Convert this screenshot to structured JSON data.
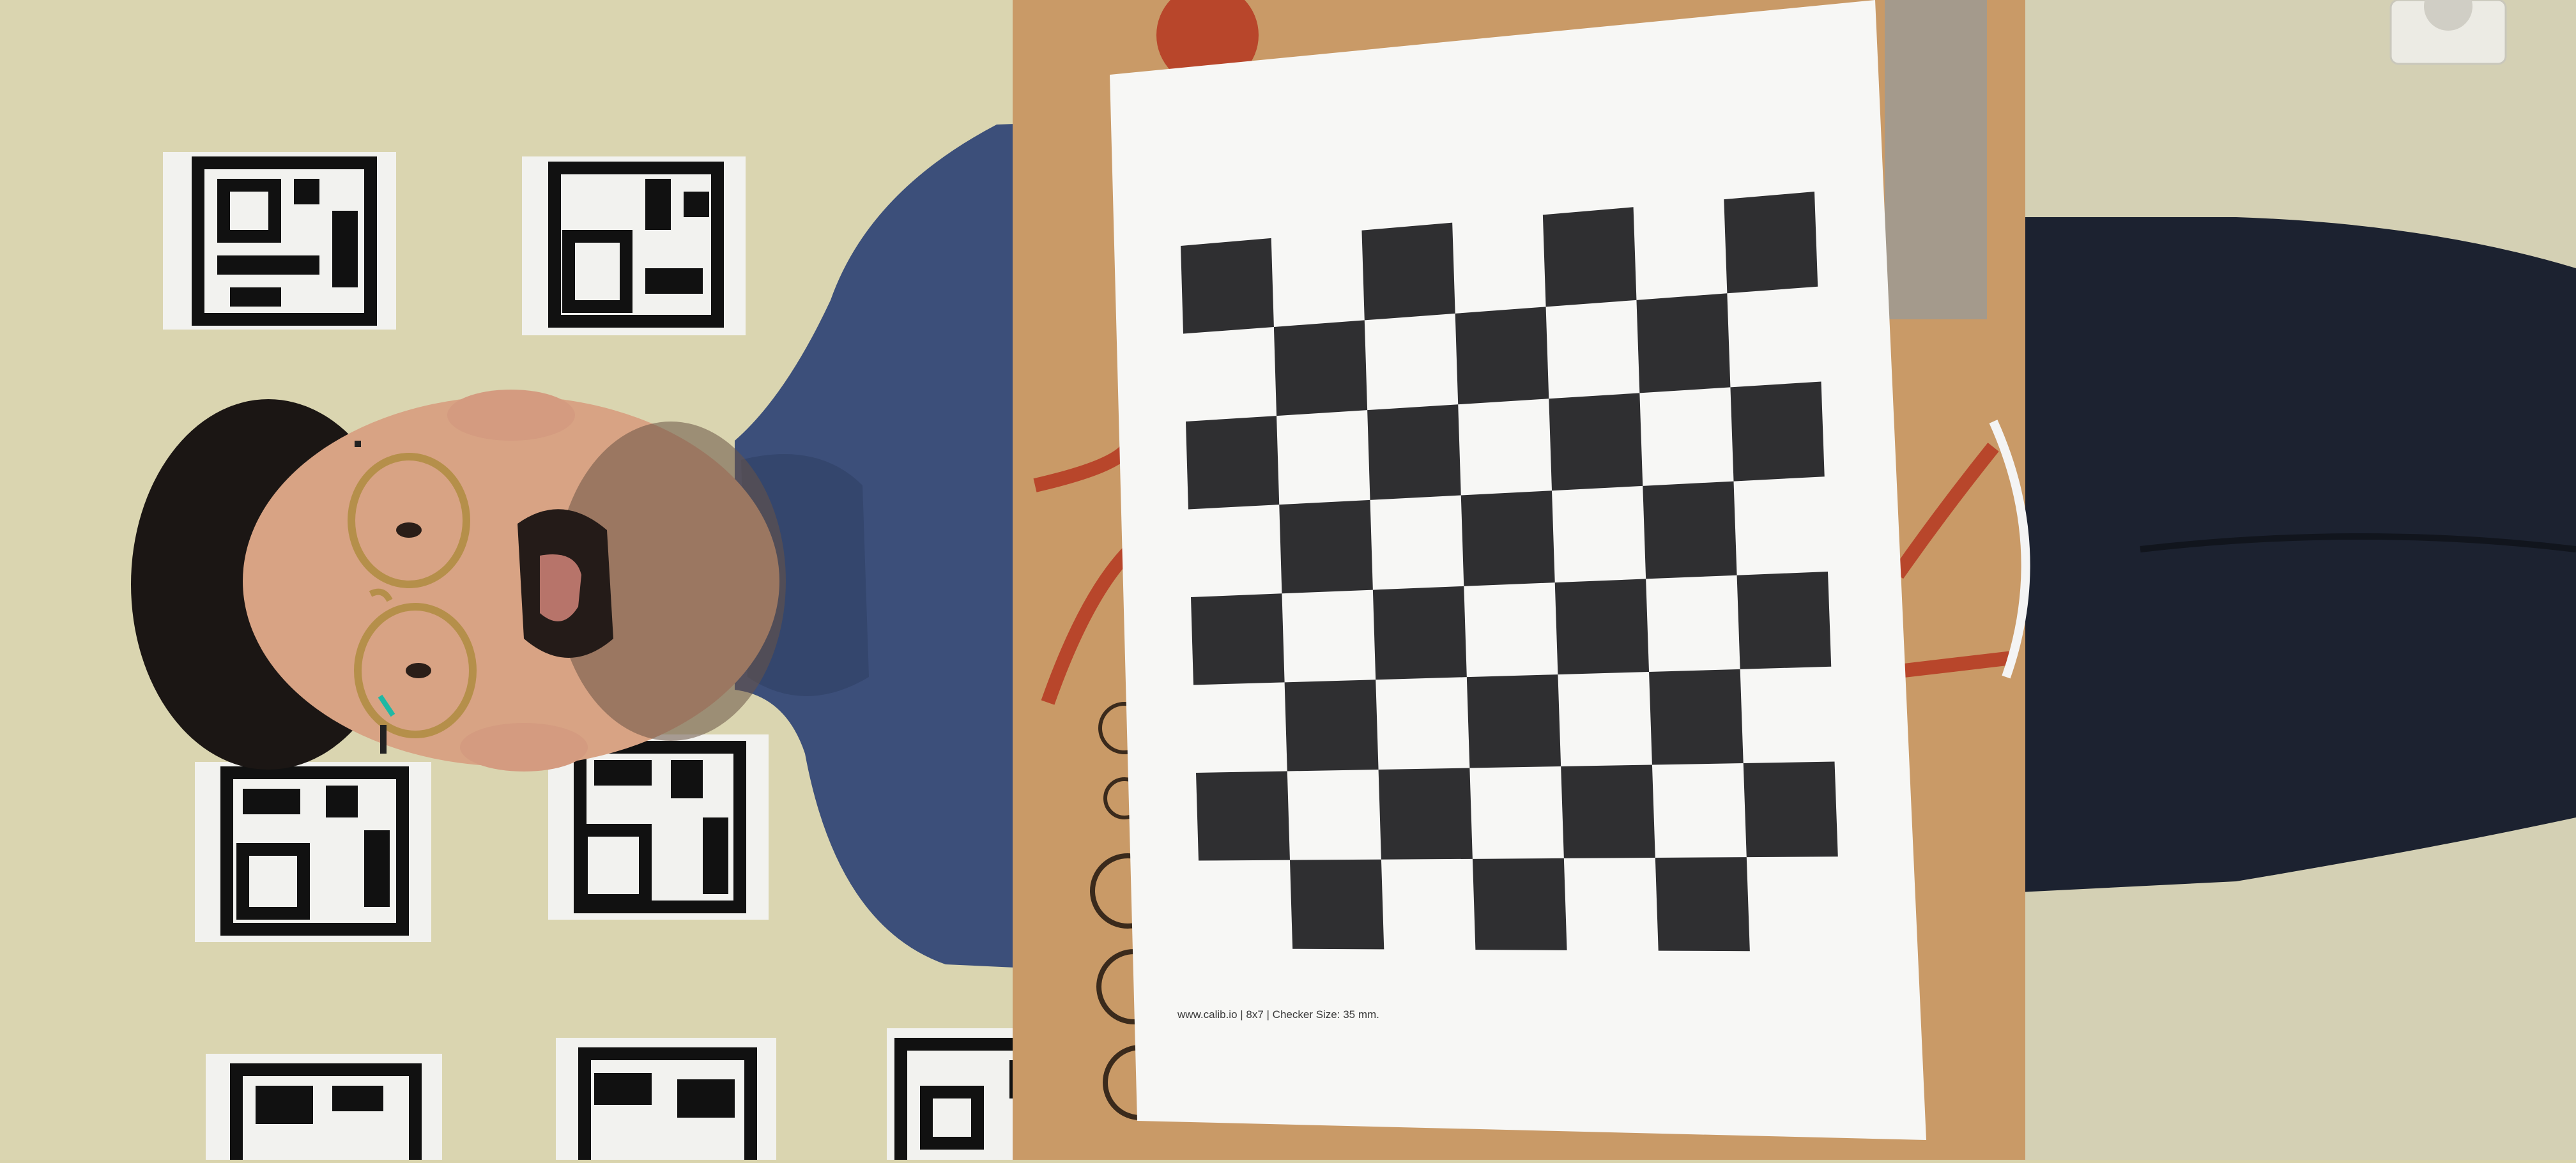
{
  "scene": {
    "description_hidden": false,
    "calibration_target": {
      "caption": "www.calib.io | 8x7 | Checker Size: 35 mm.",
      "rows": 7,
      "cols": 8
    },
    "colors": {
      "wall": "#d9d4ad",
      "wall_right": "#d3cfb2",
      "cardboard": "#c79866",
      "sweater": "#3b4e78",
      "trousers": "#1d2330",
      "skin": "#d9a487",
      "hair": "#1a1513",
      "paper": "#f7f7f5",
      "checker_dark": "#2f2f31",
      "red_stripe": "#b8462b"
    }
  }
}
